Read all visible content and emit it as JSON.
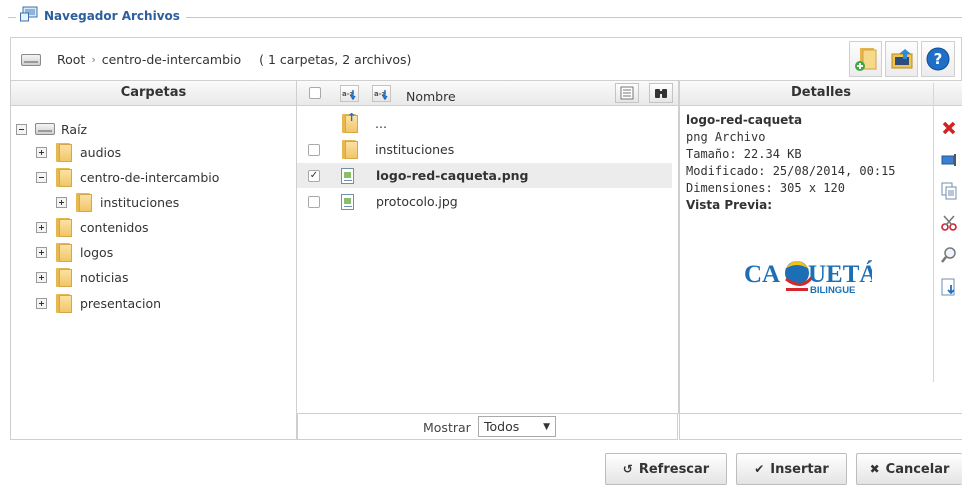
{
  "header": {
    "title": "Navegador Archivos"
  },
  "toolbar": {
    "path_root": "Root",
    "path_separator": "›",
    "path_current": "centro-de-intercambio",
    "summary": "( 1 carpetas, 2 archivos)"
  },
  "folders_panel": {
    "title": "Carpetas",
    "tree": [
      {
        "label": "Raíz",
        "level": 0,
        "expanded": true
      },
      {
        "label": "audios",
        "level": 1,
        "expanded": false
      },
      {
        "label": "centro-de-intercambio",
        "level": 1,
        "expanded": true
      },
      {
        "label": "instituciones",
        "level": 2,
        "expanded": false
      },
      {
        "label": "contenidos",
        "level": 1,
        "expanded": false
      },
      {
        "label": "logos",
        "level": 1,
        "expanded": false
      },
      {
        "label": "noticias",
        "level": 1,
        "expanded": false
      },
      {
        "label": "presentacion",
        "level": 1,
        "expanded": false
      }
    ]
  },
  "files_panel": {
    "column_name": "Nombre",
    "items": [
      {
        "name": "...",
        "type": "up"
      },
      {
        "name": "instituciones",
        "type": "folder",
        "checked": false
      },
      {
        "name": "logo-red-caqueta.png",
        "type": "file",
        "checked": true,
        "selected": true
      },
      {
        "name": "protocolo.jpg",
        "type": "file",
        "checked": false
      }
    ],
    "show_label": "Mostrar",
    "show_value": "Todos"
  },
  "details_panel": {
    "title": "Detalles",
    "name": "logo-red-caqueta",
    "type": "png Archivo",
    "size": "Tamaño: 22.34 KB",
    "modified": "Modificado: 25/08/2014, 00:15",
    "dimensions": "Dimensiones: 305 x 120",
    "preview_label": "Vista Previa:",
    "preview_logo": {
      "word": "CA",
      "word2": "UETÁ",
      "sub": "BILINGUE"
    }
  },
  "buttons": {
    "refresh": "Refrescar",
    "insert": "Insertar",
    "cancel": "Cancelar"
  },
  "colors": {
    "title_blue": "#2b5f9e",
    "logo_blue": "#1c6fb5",
    "logo_red": "#d6262b",
    "logo_yellow": "#f2c21a"
  }
}
